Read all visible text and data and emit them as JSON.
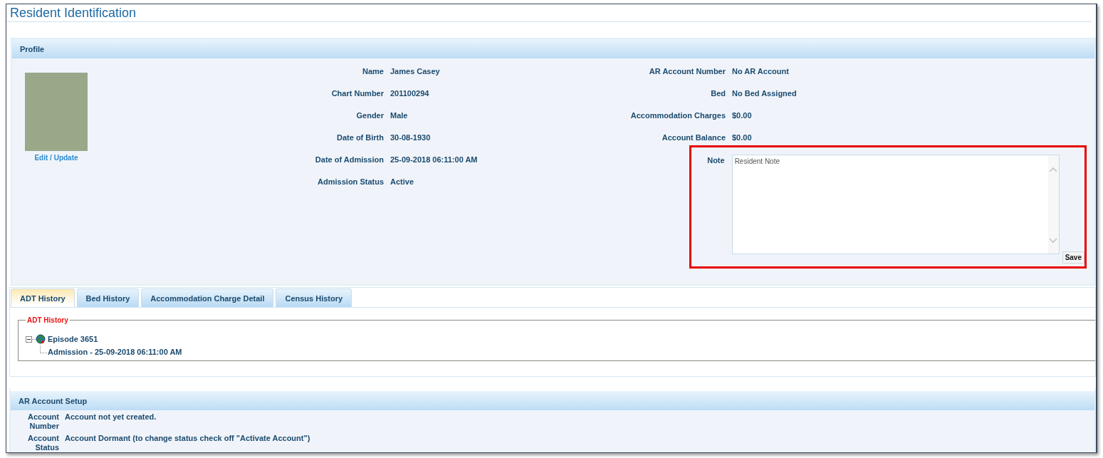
{
  "title": "Resident Identification",
  "profile": {
    "heading": "Profile",
    "photo_link": "Edit / Update",
    "left_fields": [
      {
        "label": "Name",
        "value": "James Casey"
      },
      {
        "label": "Chart Number",
        "value": "201100294"
      },
      {
        "label": "Gender",
        "value": "Male"
      },
      {
        "label": "Date of Birth",
        "value": "30-08-1930"
      },
      {
        "label": "Date of Admission",
        "value": "25-09-2018 06:11:00 AM"
      },
      {
        "label": "Admission Status",
        "value": "Active"
      }
    ],
    "right_fields": [
      {
        "label": "AR Account Number",
        "value": "No AR Account"
      },
      {
        "label": "Bed",
        "value": "No Bed Assigned"
      },
      {
        "label": "Accommodation Charges",
        "value": "$0.00"
      },
      {
        "label": "Account Balance",
        "value": "$0.00"
      }
    ],
    "note": {
      "label": "Note",
      "placeholder": "Resident Note",
      "save": "Save"
    }
  },
  "tabs": [
    {
      "label": "ADT History",
      "selected": true
    },
    {
      "label": "Bed History",
      "selected": false
    },
    {
      "label": "Accommodation Charge Detail",
      "selected": false
    },
    {
      "label": "Census History",
      "selected": false
    }
  ],
  "adt_history": {
    "legend": "ADT History",
    "tree": [
      {
        "label": "Episode 3651",
        "expanded": true,
        "children": [
          {
            "label": "Admission - 25-09-2018 06:11:00 AM"
          }
        ]
      }
    ]
  },
  "ar_setup": {
    "heading": "AR Account Setup",
    "fields": [
      {
        "label": "Account Number",
        "value": "Account not yet created."
      },
      {
        "label": "Account Status",
        "value": "Account Dormant (to change status check off \"Activate Account\")"
      }
    ]
  }
}
